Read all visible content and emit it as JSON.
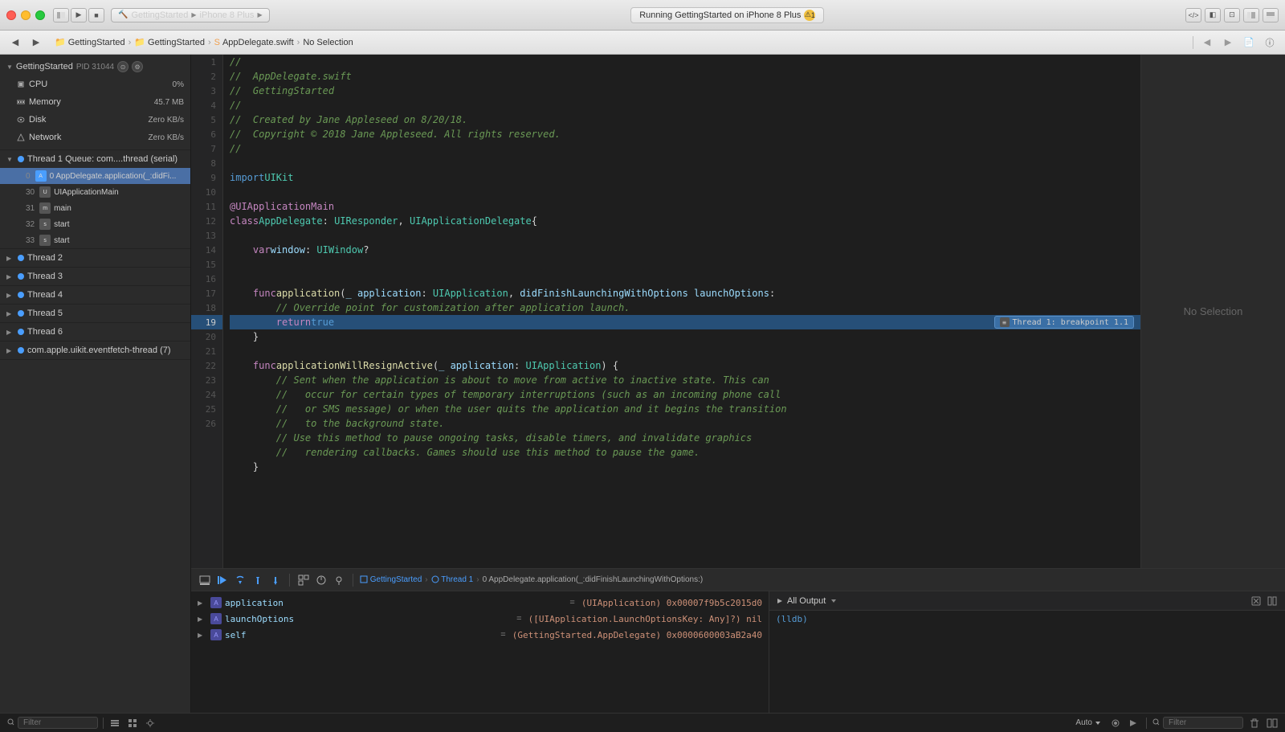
{
  "titleBar": {
    "scheme": "GettingStarted",
    "device": "iPhone 8 Plus",
    "statusText": "Running GettingStarted on iPhone 8 Plus",
    "warningCount": "1"
  },
  "breadcrumb": {
    "items": [
      "GettingStarted",
      "GettingStarted",
      "AppDelegate.swift",
      "No Selection"
    ]
  },
  "sidebar": {
    "processName": "GettingStarted",
    "processPID": "PID 31044",
    "metrics": [
      {
        "name": "CPU",
        "value": "0%"
      },
      {
        "name": "Memory",
        "value": "45.7 MB"
      },
      {
        "name": "Disk",
        "value": "Zero KB/s"
      },
      {
        "name": "Network",
        "value": "Zero KB/s"
      }
    ],
    "threads": [
      {
        "name": "Thread 1",
        "subtitle": "Queue: com....thread (serial)",
        "expanded": true,
        "items": [
          {
            "num": "0",
            "label": "0 AppDelegate.application(_:didFi...",
            "selected": true
          },
          {
            "num": "30",
            "label": "UIApplicationMain"
          },
          {
            "num": "31",
            "label": "main"
          },
          {
            "num": "32",
            "label": "start"
          },
          {
            "num": "33",
            "label": "start"
          }
        ]
      },
      {
        "name": "Thread 2",
        "expanded": false
      },
      {
        "name": "Thread 3",
        "expanded": false
      },
      {
        "name": "Thread 4",
        "expanded": false
      },
      {
        "name": "Thread 5",
        "expanded": false
      },
      {
        "name": "Thread 6",
        "expanded": false
      },
      {
        "name": "com.apple.uikit.eventfetch-thread",
        "count": "7",
        "expanded": false
      }
    ]
  },
  "editor": {
    "filename": "AppDelegate.swift",
    "lines": [
      {
        "num": 1,
        "code": "//"
      },
      {
        "num": 2,
        "code": "//  AppDelegate.swift"
      },
      {
        "num": 3,
        "code": "//  GettingStarted"
      },
      {
        "num": 4,
        "code": "//"
      },
      {
        "num": 5,
        "code": "//  Created by Jane Appleseed on 8/20/18."
      },
      {
        "num": 6,
        "code": "//  Copyright © 2018 Jane Appleseed. All rights reserved."
      },
      {
        "num": 7,
        "code": "//"
      },
      {
        "num": 8,
        "code": ""
      },
      {
        "num": 9,
        "code": "import UIKit"
      },
      {
        "num": 10,
        "code": ""
      },
      {
        "num": 11,
        "code": "@UIApplicationMain"
      },
      {
        "num": 12,
        "code": "class AppDelegate: UIResponder, UIApplicationDelegate {"
      },
      {
        "num": 13,
        "code": ""
      },
      {
        "num": 14,
        "code": "    var window: UIWindow?"
      },
      {
        "num": 15,
        "code": ""
      },
      {
        "num": 16,
        "code": ""
      },
      {
        "num": 17,
        "code": "    func application(_ application: UIApplication, didFinishLaunchingWithOptions launchOptions:"
      },
      {
        "num": 18,
        "code": "        // Override point for customization after application launch."
      },
      {
        "num": 19,
        "code": "        return true",
        "highlighted": true,
        "breakpoint": "Thread 1: breakpoint 1.1"
      },
      {
        "num": 20,
        "code": "    }"
      },
      {
        "num": 21,
        "code": ""
      },
      {
        "num": 22,
        "code": "    func applicationWillResignActive(_ application: UIApplication) {"
      },
      {
        "num": 23,
        "code": "        // Sent when the application is about to move from active to inactive state. This can"
      },
      {
        "num": 24,
        "code": "        // Use this method to pause ongoing tasks, disable timers, and invalidate graphics"
      },
      {
        "num": 25,
        "code": "    }"
      },
      {
        "num": 26,
        "code": ""
      }
    ]
  },
  "debugToolbar": {
    "breadcrumb": [
      "GettingStarted",
      "Thread 1",
      "0 AppDelegate.application(_:didFinishLaunchingWithOptions:)"
    ]
  },
  "variables": [
    {
      "name": "application",
      "value": "(UIApplication) 0x00007f9b5c2015d0"
    },
    {
      "name": "launchOptions",
      "value": "([UIApplication.LaunchOptionsKey: Any]?) nil"
    },
    {
      "name": "self",
      "value": "(GettingStarted.AppDelegate) 0x0000600003aB2a40"
    }
  ],
  "console": {
    "title": "All Output",
    "content": "(lldb)"
  },
  "statusBar": {
    "filterLabel": "Filter",
    "autoLabel": "Auto",
    "outputLabel": "All Output",
    "filterPlaceholder": "Filter"
  },
  "noSelection": "No Selection"
}
